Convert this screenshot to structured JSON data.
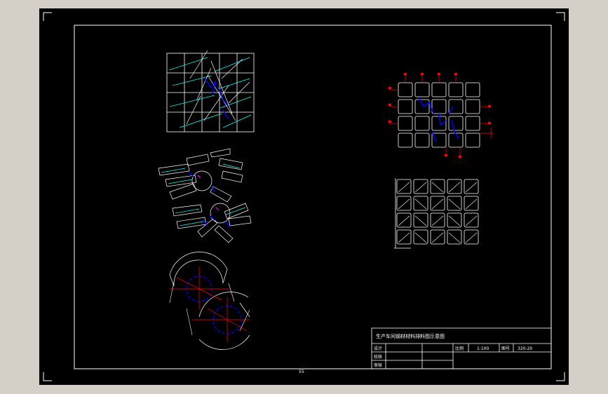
{
  "title_block": {
    "title": "生产车间钢材材料排料图示意图",
    "designer_label": "设计",
    "checker_label": "校核",
    "approver_label": "审核",
    "scale_label": "比例",
    "scale_value": "1:100",
    "drawing_no_label": "图号",
    "drawing_no_value": "320-20"
  },
  "colors": {
    "background": "#000000",
    "frame": "#ffffff",
    "line": "#ffffff",
    "cyan": "#00ffff",
    "red": "#ff0000",
    "blue": "#0000ff",
    "magenta": "#ff00ff"
  },
  "footer_mark": "55"
}
